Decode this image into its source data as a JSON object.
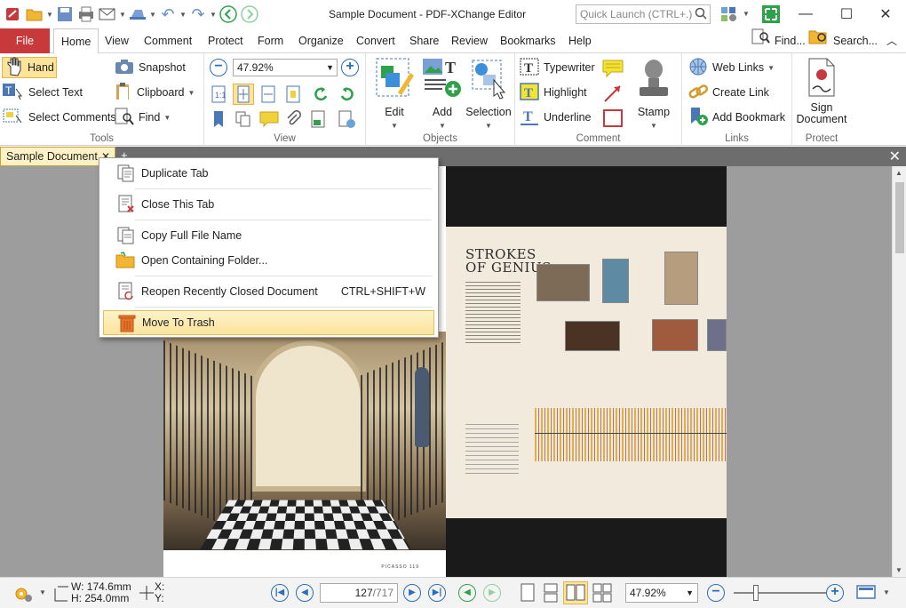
{
  "app": {
    "title": "Sample Document - PDF-XChange Editor",
    "quick_launch_placeholder": "Quick Launch (CTRL+.)"
  },
  "menu_tabs": [
    "File",
    "Home",
    "View",
    "Comment",
    "Protect",
    "Form",
    "Organize",
    "Convert",
    "Share",
    "Review",
    "Bookmarks",
    "Help"
  ],
  "menu_right": {
    "find": "Find...",
    "search": "Search..."
  },
  "ribbon": {
    "tools": {
      "hand": "Hand",
      "select_text": "Select Text",
      "select_comments": "Select Comments",
      "snapshot": "Snapshot",
      "clipboard": "Clipboard",
      "find": "Find",
      "label": "Tools"
    },
    "view": {
      "zoom": "47.92%",
      "label": "View"
    },
    "objects": {
      "edit": "Edit",
      "add": "Add",
      "selection": "Selection",
      "label": "Objects"
    },
    "comment": {
      "typewriter": "Typewriter",
      "highlight": "Highlight",
      "underline": "Underline",
      "stamp": "Stamp",
      "label": "Comment"
    },
    "links": {
      "web_links": "Web Links",
      "create_link": "Create Link",
      "add_bookmark": "Add Bookmark",
      "label": "Links"
    },
    "protect": {
      "sign_document_1": "Sign",
      "sign_document_2": "Document",
      "label": "Protect"
    }
  },
  "document_tab": {
    "name": "Sample Document"
  },
  "context_menu": {
    "items": [
      {
        "label": "Duplicate Tab",
        "shortcut": ""
      },
      {
        "label": "Close This Tab",
        "shortcut": ""
      },
      {
        "label": "Copy Full File Name",
        "shortcut": ""
      },
      {
        "label": "Open Containing Folder...",
        "shortcut": ""
      },
      {
        "label": "Reopen Recently Closed Document",
        "shortcut": "CTRL+SHIFT+W"
      },
      {
        "label": "Move To Trash",
        "shortcut": ""
      }
    ]
  },
  "document": {
    "headline_1": "STROKES",
    "headline_2": "OF GENIUS",
    "left_footer": "PICASSO  119"
  },
  "status": {
    "width": "W: 174.6mm",
    "height": "H: 254.0mm",
    "x": "X:",
    "y": "Y:",
    "page_current": "127",
    "page_total": "/717",
    "zoom": "47.92%"
  },
  "colors": {
    "file_tab": "#c8393c",
    "accent_blue": "#2b6fb6",
    "highlight": "#fce49a",
    "doc_background": "#9d9d9d"
  }
}
